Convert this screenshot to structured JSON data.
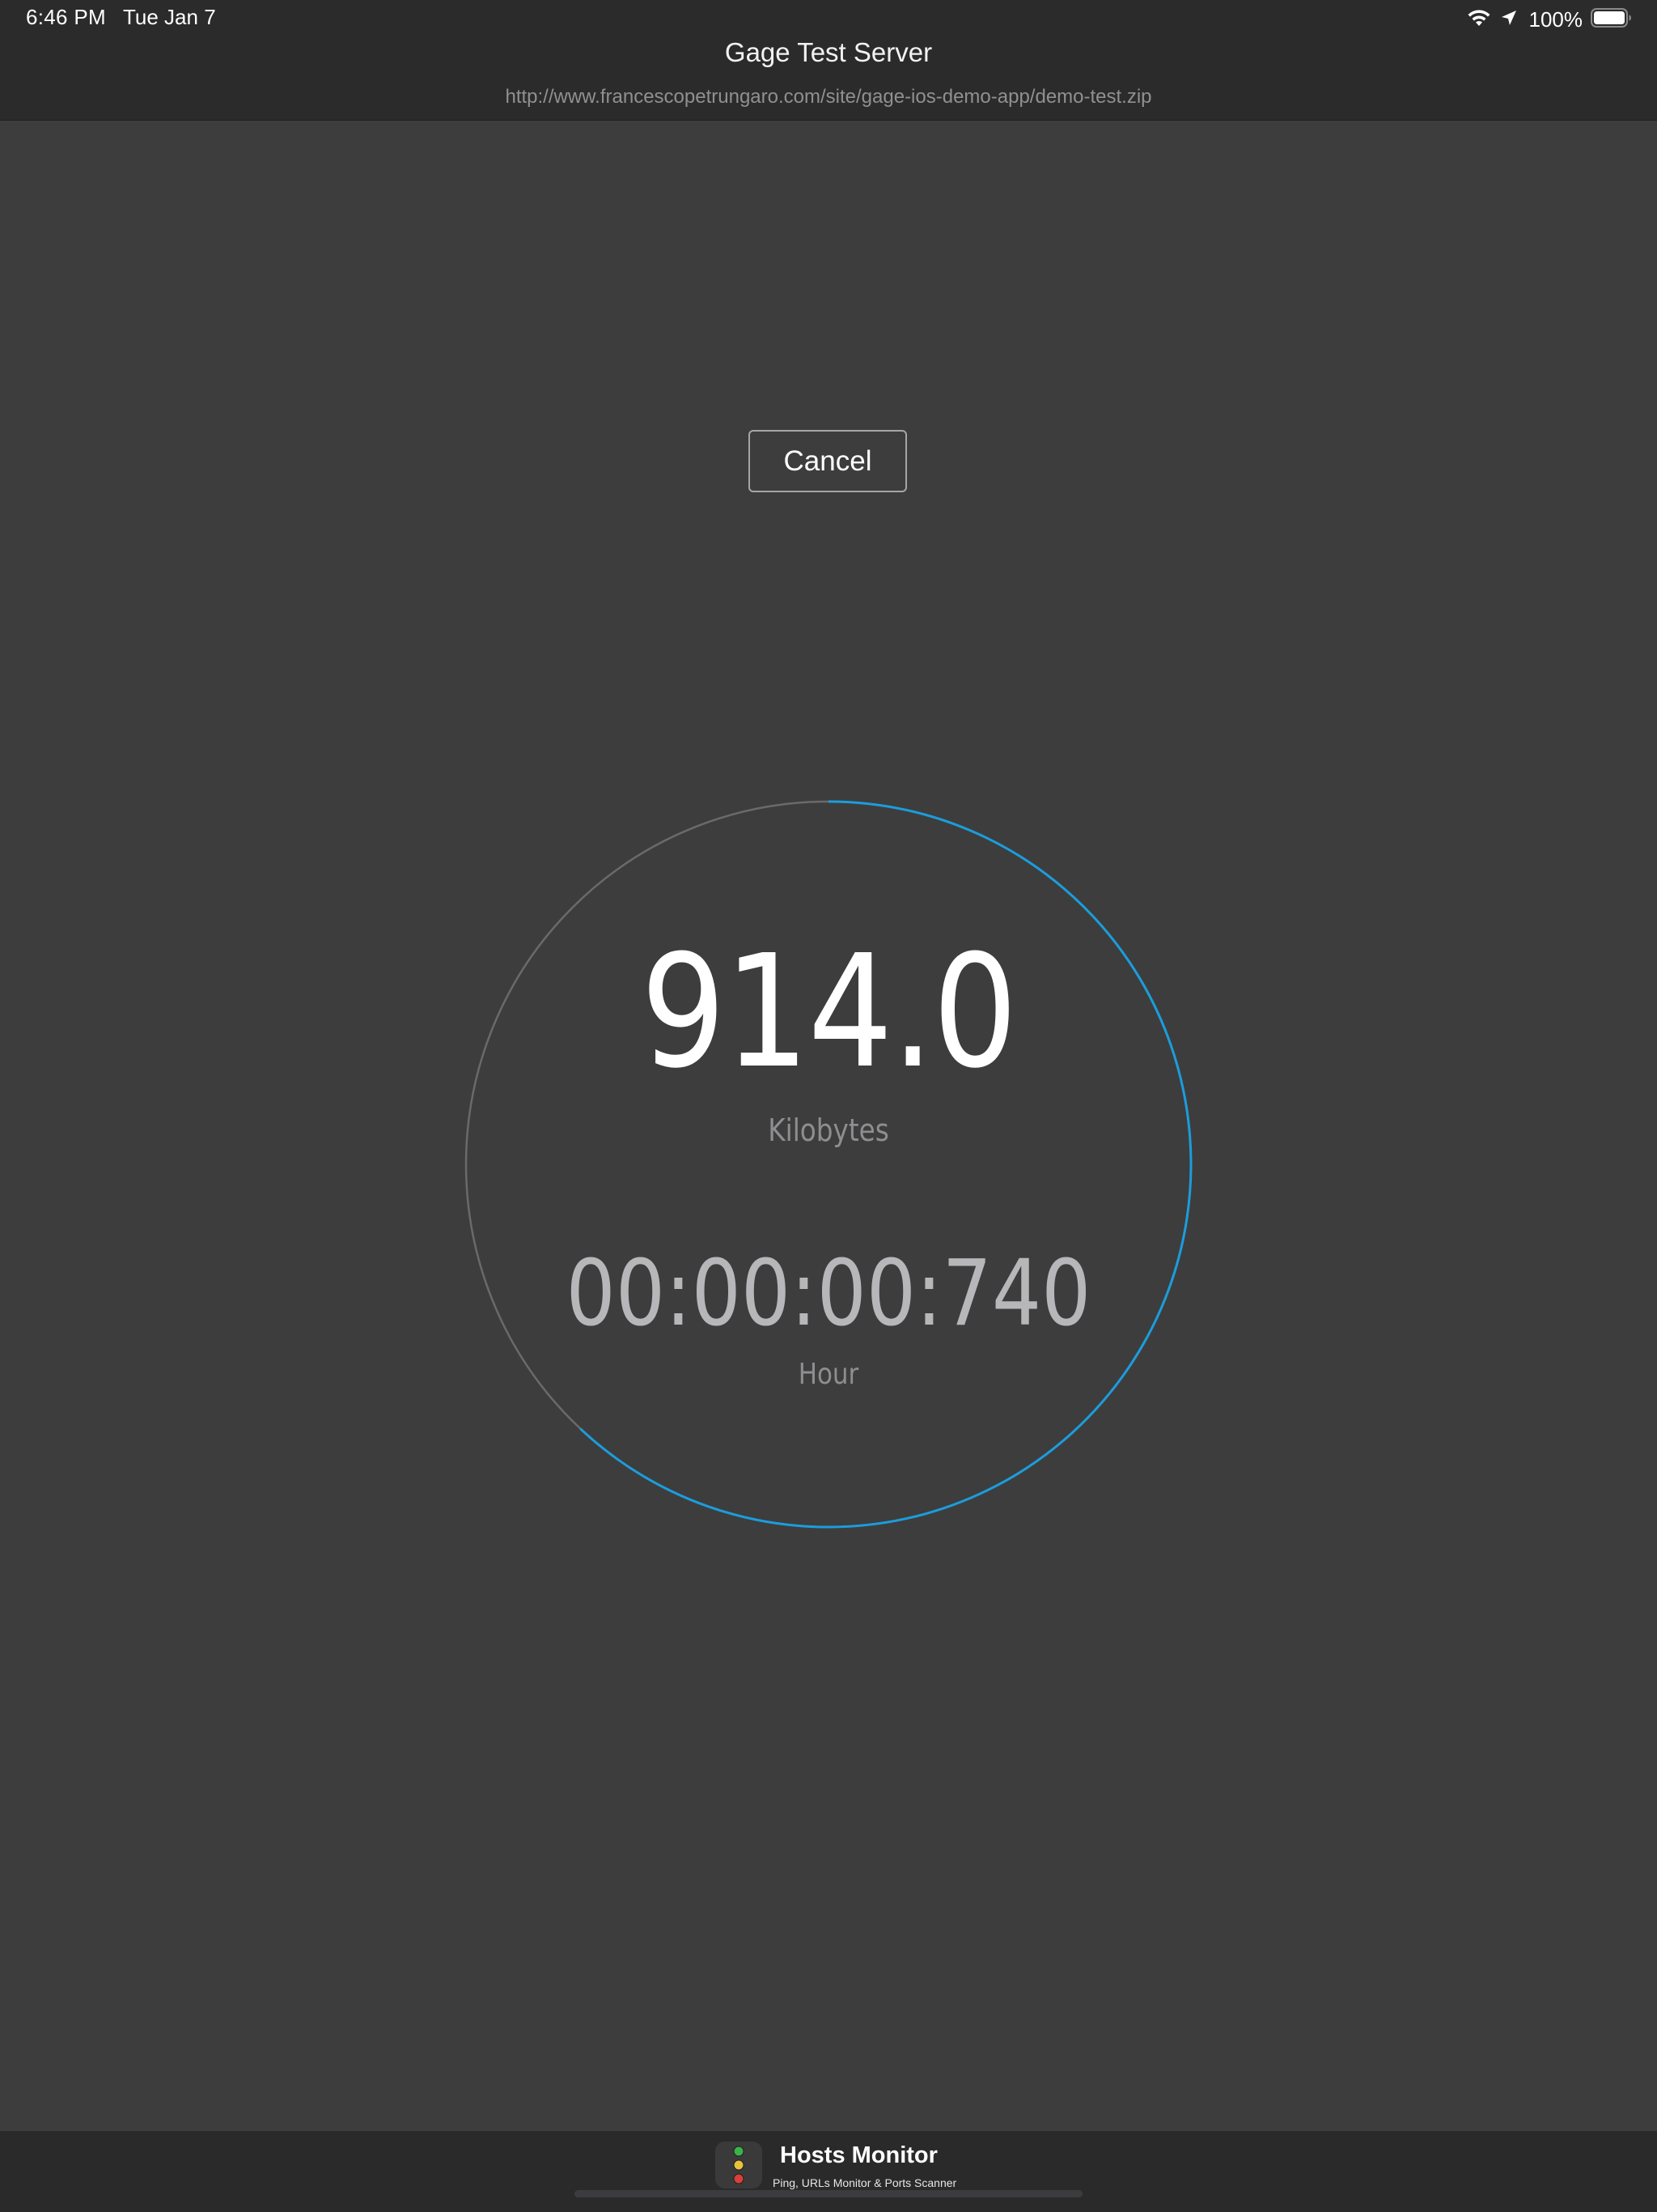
{
  "status_bar": {
    "time": "6:46 PM",
    "date": "Tue Jan 7",
    "battery": "100%",
    "icons": [
      "wifi-icon",
      "location-arrow-icon",
      "battery-icon"
    ]
  },
  "nav": {
    "title": "Gage Test Server",
    "url": "http://www.francescopetrungaro.com/site/gage-ios-demo-app/demo-test.zip"
  },
  "controls": {
    "cancel_label": "Cancel"
  },
  "gauge": {
    "value": "914.0",
    "value_unit": "Kilobytes",
    "elapsed": "00:00:00:740",
    "elapsed_unit": "Hour",
    "progress": 0.62,
    "colors": {
      "progress": "#1b9ddc",
      "track": "#6a6a6c"
    }
  },
  "ad": {
    "title": "Hosts Monitor",
    "subtitle": "Ping, URLs Monitor & Ports Scanner",
    "icon": "traffic-light-icon",
    "colors": {
      "green": "#3bb34a",
      "yellow": "#e8c23a",
      "red": "#d8403a"
    }
  }
}
